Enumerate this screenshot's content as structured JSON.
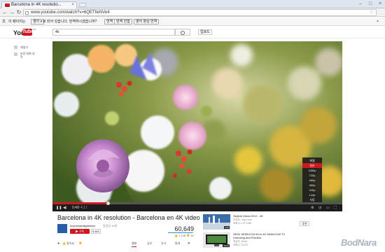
{
  "browser": {
    "tab_title": "Barcelona in 4K resolutio...",
    "url": "www.youtube.com/watch?v=6QETIleNVe4",
    "translate": {
      "page_label": "이 페이지는",
      "source_lang": "영어",
      "message": "로 되어 있습니다. 번역하시겠습니까?",
      "translate_button": "번역",
      "never_button": "번역 안함",
      "always_button": "영어 항상 번역"
    }
  },
  "youtube": {
    "logo_you": "You",
    "logo_tube": "Tube",
    "logo_sup": "KR",
    "search_value": "4k",
    "upload_label": "업로드",
    "sidebar": [
      {
        "label": "재생기",
        "icon": "list-icon"
      },
      {
        "label": "분류 대화 외 목",
        "icon": "list-icon"
      }
    ]
  },
  "player": {
    "time_current": "0:40",
    "time_total": "4:17",
    "progress": 0.19,
    "quality_menu": {
      "title": "화질",
      "options": [
        "원본",
        "1080p",
        "720p",
        "480p",
        "360p",
        "240p",
        "144p",
        "자동"
      ],
      "selected_index": 0
    }
  },
  "video": {
    "title": "Barcelona in 4K resolution - Barcelona en 4K video",
    "channel": "Improvisedlightmare",
    "channel_sub": "동영상 16개",
    "subscribe_label": "구독",
    "subscriber_count": "5,451",
    "views": "60,649",
    "likes": "1,148",
    "dislikes": "18",
    "actions": {
      "like": "좋아요"
    },
    "tabs": [
      "정보",
      "공유",
      "추가",
      "통계"
    ],
    "active_tab": 0
  },
  "related": [
    {
      "title": "Skyline Dubai 2012 - 4K",
      "channel": "작성자: Voyo.com",
      "views": "조회수 1,377,086",
      "duration": "4:00"
    },
    {
      "title": "SEIKI SE50UY04 50-in 4K 3840x2160 TV Unboxing and Preview",
      "channel": "작성자: HiDef",
      "views": "조회수 73,374",
      "duration": "10:41"
    }
  ],
  "related_sub_label": "추천",
  "watermark": "BodNara",
  "colors": {
    "youtube_red": "#cc181e",
    "like_blue": "#2793e6"
  }
}
